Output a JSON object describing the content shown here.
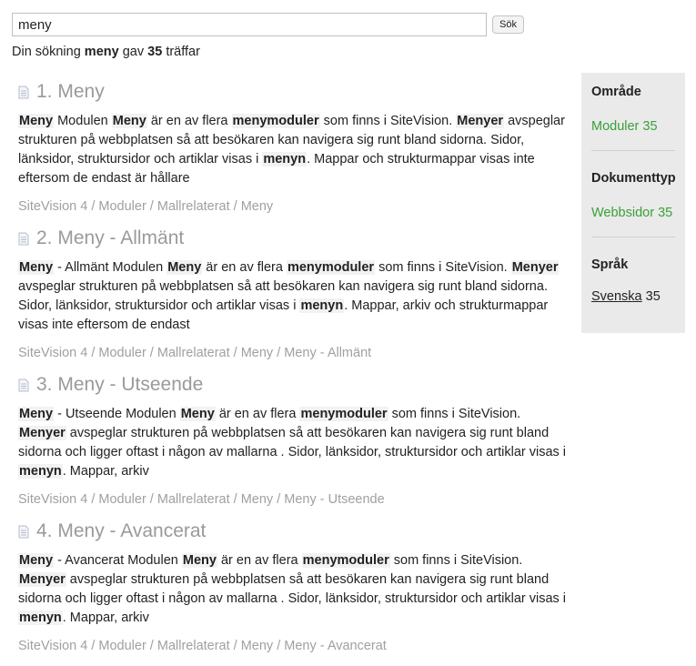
{
  "search": {
    "value": "meny",
    "button_label": "Sök"
  },
  "summary": {
    "prefix": "Din sökning",
    "query": "meny",
    "middle": "gav",
    "count": "35",
    "suffix": "träffar"
  },
  "results": [
    {
      "title": "1. Meny",
      "snippet": [
        {
          "t": "Meny",
          "b": true
        },
        {
          "t": " Modulen "
        },
        {
          "t": "Meny",
          "b": true
        },
        {
          "t": " är en av flera "
        },
        {
          "t": "menymoduler",
          "b": true
        },
        {
          "t": " som finns i SiteVision. "
        },
        {
          "t": "Menyer",
          "b": true
        },
        {
          "t": " avspeglar strukturen på webbplatsen så att besökaren kan navigera sig runt bland sidorna. Sidor, länksidor, struktursidor och artiklar visas i "
        },
        {
          "t": "menyn",
          "b": true
        },
        {
          "t": ". Mappar och strukturmappar visas inte eftersom de endast är hållare"
        }
      ],
      "breadcrumb": "SiteVision 4 / Moduler / Mallrelaterat / Meny"
    },
    {
      "title": "2. Meny - Allmänt",
      "snippet": [
        {
          "t": "Meny",
          "b": true
        },
        {
          "t": " - Allmänt Modulen "
        },
        {
          "t": "Meny",
          "b": true
        },
        {
          "t": " är en av flera "
        },
        {
          "t": "menymoduler",
          "b": true
        },
        {
          "t": " som finns i SiteVision. "
        },
        {
          "t": "Menyer",
          "b": true
        },
        {
          "t": " avspeglar strukturen på webbplatsen så att besökaren kan navigera sig runt bland sidorna. Sidor, länksidor, struktursidor och artiklar visas i "
        },
        {
          "t": "menyn",
          "b": true
        },
        {
          "t": ". Mappar, arkiv och strukturmappar visas inte eftersom de endast"
        }
      ],
      "breadcrumb": "SiteVision 4 / Moduler / Mallrelaterat / Meny / Meny - Allmänt"
    },
    {
      "title": "3. Meny - Utseende",
      "snippet": [
        {
          "t": "Meny",
          "b": true
        },
        {
          "t": " - Utseende Modulen "
        },
        {
          "t": "Meny",
          "b": true
        },
        {
          "t": " är en av flera "
        },
        {
          "t": "menymoduler",
          "b": true
        },
        {
          "t": " som finns i SiteVision. "
        },
        {
          "t": "Menyer",
          "b": true
        },
        {
          "t": " avspeglar strukturen på webbplatsen så att besökaren kan navigera sig runt bland sidorna och ligger oftast i någon av mallarna . Sidor, länksidor, struktursidor och artiklar visas i "
        },
        {
          "t": "menyn",
          "b": true
        },
        {
          "t": ". Mappar, arkiv"
        }
      ],
      "breadcrumb": "SiteVision 4 / Moduler / Mallrelaterat / Meny / Meny - Utseende"
    },
    {
      "title": "4. Meny - Avancerat",
      "snippet": [
        {
          "t": "Meny",
          "b": true
        },
        {
          "t": " - Avancerat Modulen "
        },
        {
          "t": "Meny",
          "b": true
        },
        {
          "t": " är en av flera "
        },
        {
          "t": "menymoduler",
          "b": true
        },
        {
          "t": " som finns i SiteVision. "
        },
        {
          "t": "Menyer",
          "b": true
        },
        {
          "t": " avspeglar strukturen på webbplatsen så att besökaren kan navigera sig runt bland sidorna och ligger oftast i någon av mallarna . Sidor, länksidor, struktursidor och artiklar visas i "
        },
        {
          "t": "menyn",
          "b": true
        },
        {
          "t": ". Mappar, arkiv"
        }
      ],
      "breadcrumb": "SiteVision 4 / Moduler / Mallrelaterat / Meny / Meny - Avancerat"
    }
  ],
  "facets": {
    "area": {
      "heading": "Område",
      "link": "Moduler 35"
    },
    "doctype": {
      "heading": "Dokumenttyp",
      "link": "Webbsidor 35"
    },
    "language": {
      "heading": "Språk",
      "link": "Svenska",
      "count": "35"
    }
  },
  "colors": {
    "facet_link": "#3aa03a",
    "facet_bg": "#eaeaea",
    "muted": "#9a9a9a"
  },
  "icons": {
    "result": "document-icon"
  }
}
